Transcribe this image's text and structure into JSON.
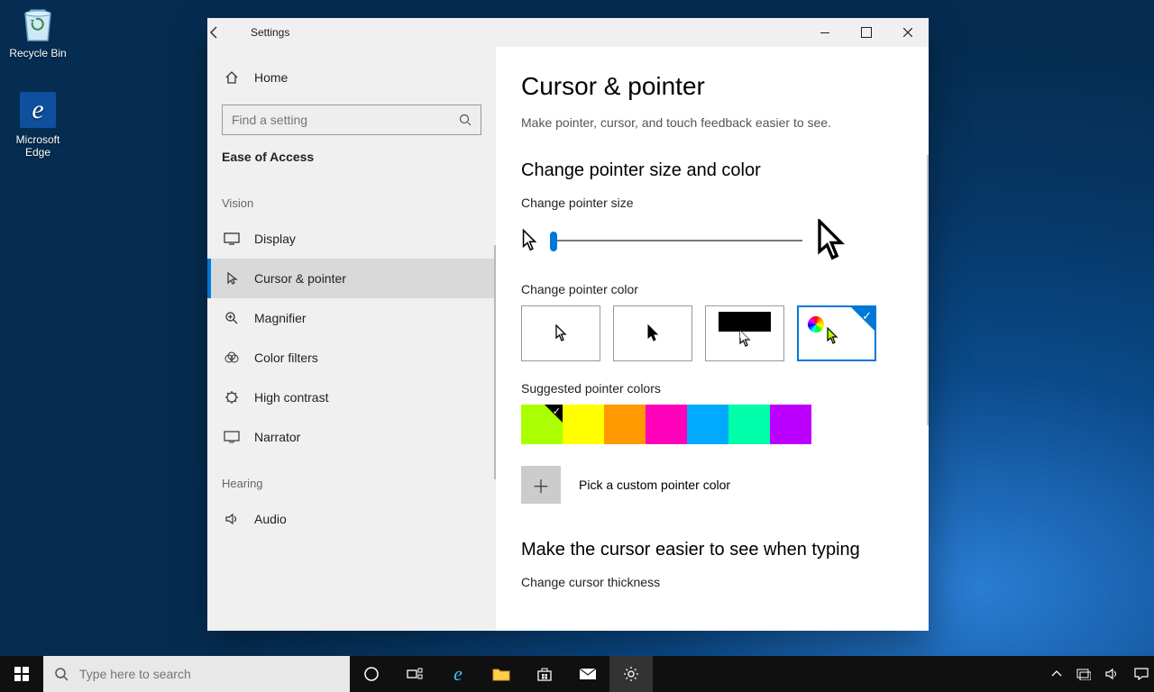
{
  "desktop": {
    "recycle": "Recycle Bin",
    "edge": "Microsoft Edge"
  },
  "window": {
    "title": "Settings",
    "home": "Home",
    "search_placeholder": "Find a setting",
    "section": "Ease of Access",
    "groups": {
      "vision": "Vision",
      "hearing": "Hearing"
    },
    "nav": {
      "display": "Display",
      "cursor": "Cursor & pointer",
      "magnifier": "Magnifier",
      "colorfilters": "Color filters",
      "highcontrast": "High contrast",
      "narrator": "Narrator",
      "audio": "Audio"
    }
  },
  "content": {
    "h1": "Cursor & pointer",
    "desc": "Make pointer, cursor, and touch feedback easier to see.",
    "h2a": "Change pointer size and color",
    "size_label": "Change pointer size",
    "color_label": "Change pointer color",
    "suggested_label": "Suggested pointer colors",
    "custom_label": "Pick a custom pointer color",
    "h2b": "Make the cursor easier to see when typing",
    "thickness_label": "Change cursor thickness",
    "suggested_colors": [
      "#aaff00",
      "#ffff00",
      "#ff9900",
      "#ff00bb",
      "#00aaff",
      "#00ffaa",
      "#bb00ff"
    ],
    "selected_swatch_index": 0,
    "selected_tile_index": 3
  },
  "taskbar": {
    "search_placeholder": "Type here to search"
  }
}
